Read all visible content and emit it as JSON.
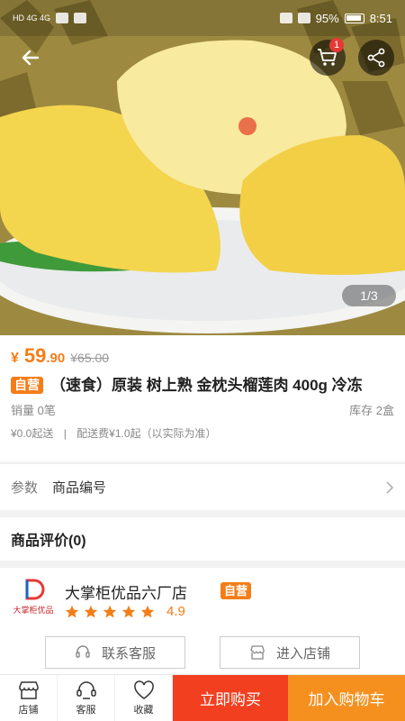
{
  "status_bar": {
    "network_left": "HD 4G 4G",
    "battery_percent": "95%",
    "time": "8:51"
  },
  "gallery": {
    "pager": "1/3",
    "cart_count": "1"
  },
  "product": {
    "price_symbol": "¥",
    "price_int": "59",
    "price_dec": ".90",
    "price_original": "¥65.00",
    "self_tag": "自营",
    "title": "（速食）原装 树上熟 金枕头榴莲肉 400g 冷冻",
    "sales": "销量 0笔",
    "stock": "库存 2盒",
    "min_order": "¥0.0起送",
    "separator": "|",
    "delivery_fee": "配送费¥1.0起（以实际为准）"
  },
  "params": {
    "label": "参数",
    "value": "商品编号"
  },
  "reviews": {
    "title": "商品评价(0)"
  },
  "store": {
    "logo_text": "大掌柜优品",
    "name": "大掌柜优品六厂店",
    "tag": "自营",
    "rating": "4.9",
    "star_count": 5,
    "service_button": "联系客服",
    "shop_button": "进入店铺"
  },
  "bottom_bar": {
    "shop": "店铺",
    "service": "客服",
    "favorite": "收藏",
    "buy_now": "立即购买",
    "add_cart": "加入购物车"
  },
  "colors": {
    "accent": "#f47d18",
    "buy": "#f23f1f",
    "cart": "#f5901f"
  },
  "icons": [
    "back-arrow-icon",
    "cart-icon",
    "share-icon",
    "chevron-right-icon",
    "star-icon",
    "headset-icon",
    "store-icon",
    "heart-icon"
  ]
}
